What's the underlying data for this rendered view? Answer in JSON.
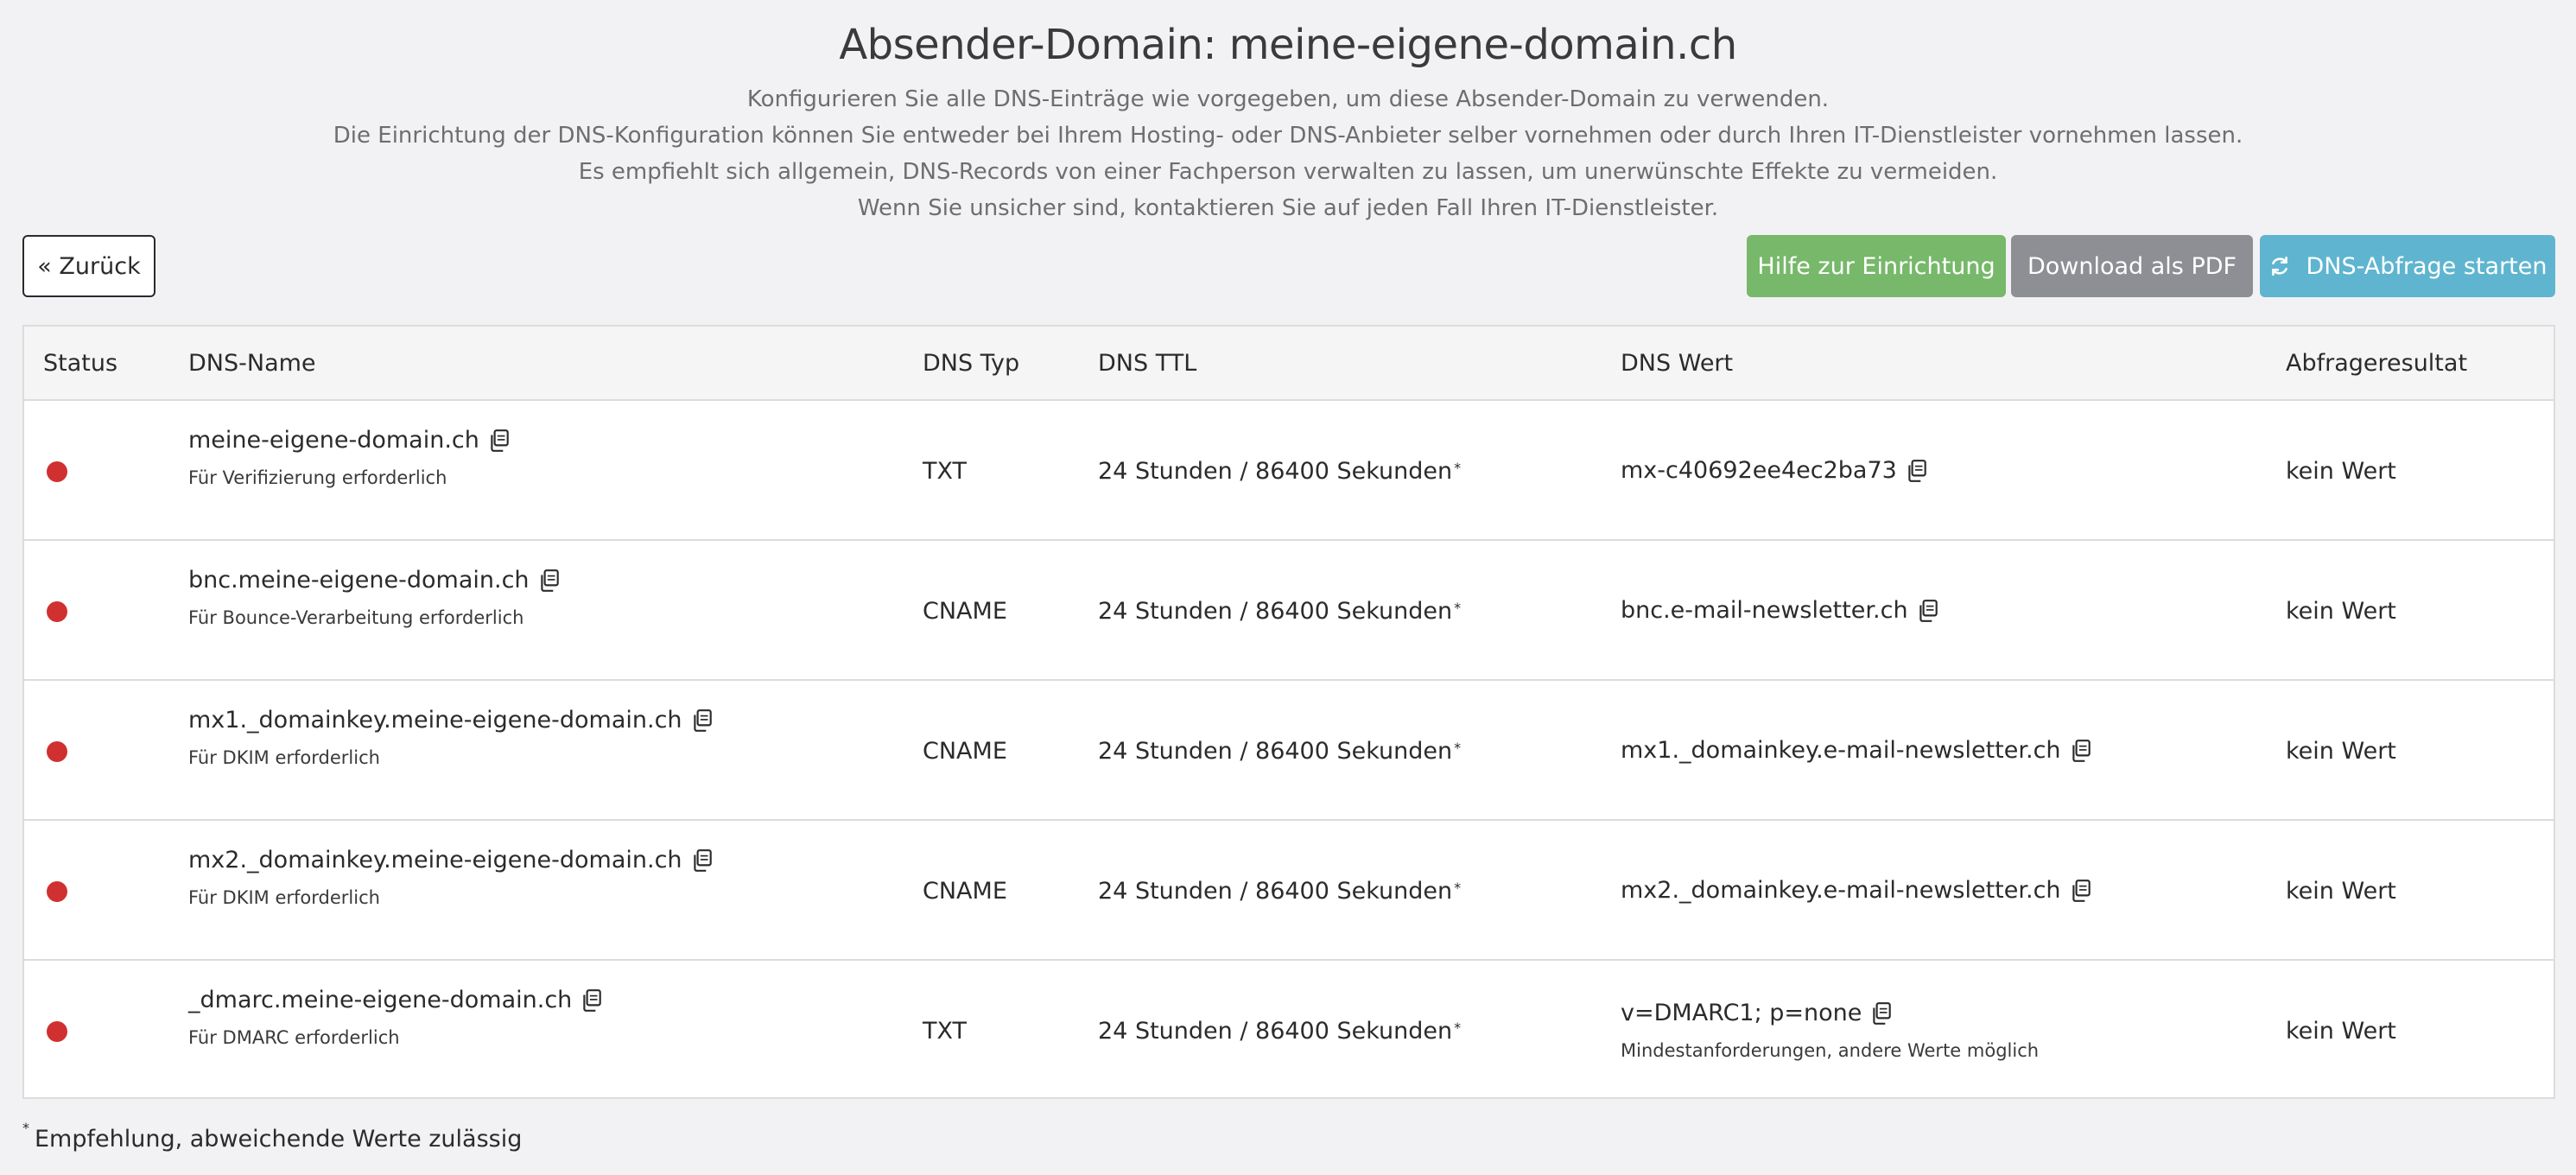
{
  "header": {
    "title": "Absender-Domain: meine-eigene-domain.ch",
    "intro_lines": [
      "Konfigurieren Sie alle DNS-Einträge wie vorgegeben, um diese Absender-Domain zu verwenden.",
      "Die Einrichtung der DNS-Konfiguration können Sie entweder bei Ihrem Hosting- oder DNS-Anbieter selber vornehmen oder durch Ihren IT-Dienstleister vornehmen lassen.",
      "Es empfiehlt sich allgemein, DNS-Records von einer Fachperson verwalten zu lassen, um unerwünschte Effekte zu vermeiden.",
      "Wenn Sie unsicher sind, kontaktieren Sie auf jeden Fall Ihren IT-Dienstleister."
    ]
  },
  "toolbar": {
    "back_label": "« Zurück",
    "help_label": "Hilfe zur Einrichtung",
    "pdf_label": "Download als PDF",
    "dns_label": "DNS-Abfrage starten",
    "dns_icon": "refresh-icon"
  },
  "colors": {
    "help_button": "#77b86a",
    "pdf_button": "#8d8f94",
    "dns_button": "#5fb5cf",
    "status_error": "#d0302f"
  },
  "table": {
    "headers": {
      "status": "Status",
      "name": "DNS-Name",
      "type": "DNS Typ",
      "ttl": "DNS TTL",
      "value": "DNS Wert",
      "result": "Abfrageresultat"
    },
    "rows": [
      {
        "status": "error",
        "name": "meine-eigene-domain.ch",
        "name_note": "Für Verifizierung erforderlich",
        "type": "TXT",
        "ttl": "24 Stunden / 86400 Sekunden",
        "ttl_mark": "*",
        "value": "mx-c40692ee4ec2ba73",
        "value_note": "",
        "result": "kein Wert"
      },
      {
        "status": "error",
        "name": "bnc.meine-eigene-domain.ch",
        "name_note": "Für Bounce-Verarbeitung erforderlich",
        "type": "CNAME",
        "ttl": "24 Stunden / 86400 Sekunden",
        "ttl_mark": "*",
        "value": "bnc.e-mail-newsletter.ch",
        "value_note": "",
        "result": "kein Wert"
      },
      {
        "status": "error",
        "name": "mx1._domainkey.meine-eigene-domain.ch",
        "name_note": "Für DKIM erforderlich",
        "type": "CNAME",
        "ttl": "24 Stunden / 86400 Sekunden",
        "ttl_mark": "*",
        "value": "mx1._domainkey.e-mail-newsletter.ch",
        "value_note": "",
        "result": "kein Wert"
      },
      {
        "status": "error",
        "name": "mx2._domainkey.meine-eigene-domain.ch",
        "name_note": "Für DKIM erforderlich",
        "type": "CNAME",
        "ttl": "24 Stunden / 86400 Sekunden",
        "ttl_mark": "*",
        "value": "mx2._domainkey.e-mail-newsletter.ch",
        "value_note": "",
        "result": "kein Wert"
      },
      {
        "status": "error",
        "name": "_dmarc.meine-eigene-domain.ch",
        "name_note": "Für DMARC erforderlich",
        "type": "TXT",
        "ttl": "24 Stunden / 86400 Sekunden",
        "ttl_mark": "*",
        "value": "v=DMARC1; p=none",
        "value_note": "Mindestanforderungen, andere Werte möglich",
        "result": "kein Wert"
      }
    ]
  },
  "footnote": {
    "mark": "*",
    "text": "Empfehlung, abweichende Werte zulässig"
  }
}
